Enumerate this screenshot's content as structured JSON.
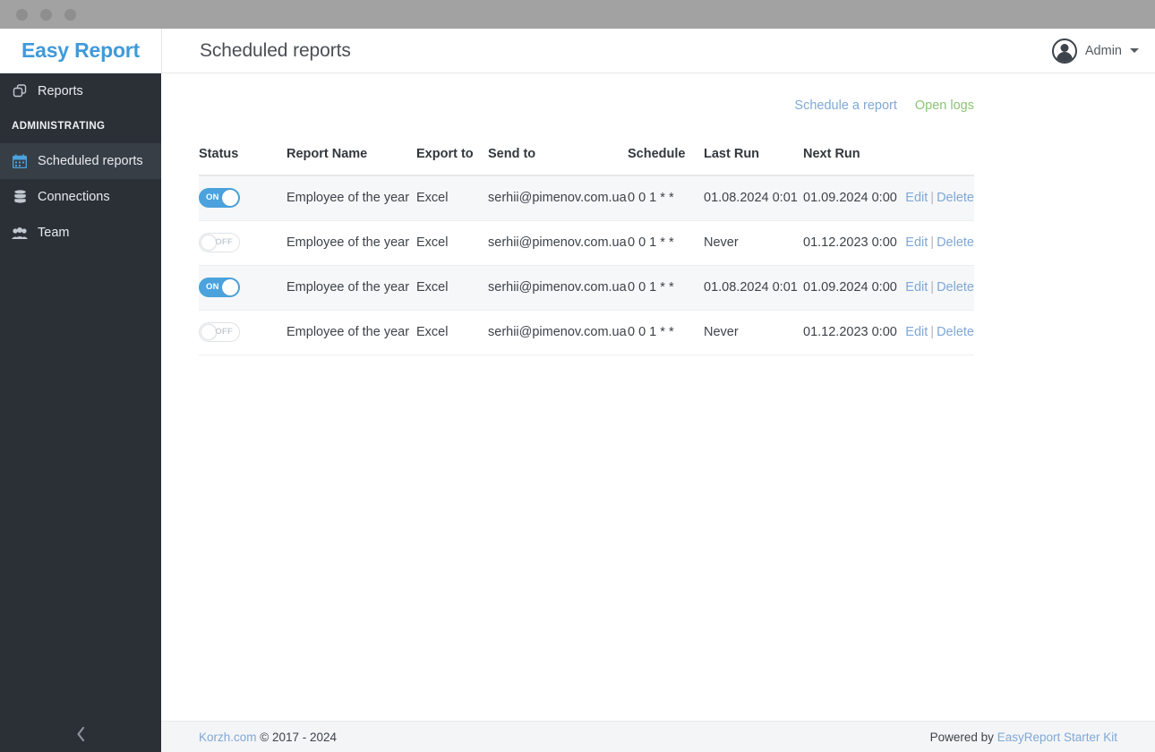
{
  "window": {
    "dots": [
      "close-dot",
      "minimize-dot",
      "maximize-dot"
    ]
  },
  "header": {
    "brand": "Easy Report",
    "page_title": "Scheduled reports",
    "user_name": "Admin"
  },
  "sidebar": {
    "items": [
      {
        "label": "Reports",
        "icon": "copy-icon",
        "active": false
      },
      {
        "label": "Scheduled reports",
        "icon": "calendar-icon",
        "active": true
      },
      {
        "label": "Connections",
        "icon": "database-icon",
        "active": false
      },
      {
        "label": "Team",
        "icon": "users-icon",
        "active": false
      }
    ],
    "section_label": "ADMINISTRATING",
    "collapse_icon": "chevron-left-icon"
  },
  "toolbar": {
    "schedule_report": "Schedule a report",
    "open_logs": "Open logs"
  },
  "table": {
    "columns": [
      "Status",
      "Report Name",
      "Export to",
      "Send to",
      "Schedule",
      "Last Run",
      "Next Run",
      ""
    ],
    "rows": [
      {
        "status": "ON",
        "enabled": true,
        "name": "Employee of the year",
        "export_to": "Excel",
        "send_to": "serhii@pimenov.com.ua",
        "schedule": "0 0 1 * *",
        "last_run": "01.08.2024 0:01",
        "next_run": "01.09.2024 0:00",
        "edit": "Edit",
        "separator": "|",
        "delete": "Delete"
      },
      {
        "status": "OFF",
        "enabled": false,
        "name": "Employee of the year",
        "export_to": "Excel",
        "send_to": "serhii@pimenov.com.ua",
        "schedule": "0 0 1 * *",
        "last_run": "Never",
        "next_run": "01.12.2023 0:00",
        "edit": "Edit",
        "separator": "|",
        "delete": "Delete"
      },
      {
        "status": "ON",
        "enabled": true,
        "name": "Employee of the year",
        "export_to": "Excel",
        "send_to": "serhii@pimenov.com.ua",
        "schedule": "0 0 1 * *",
        "last_run": "01.08.2024 0:01",
        "next_run": "01.09.2024 0:00",
        "edit": "Edit",
        "separator": "|",
        "delete": "Delete"
      },
      {
        "status": "OFF",
        "enabled": false,
        "name": "Employee of the year",
        "export_to": "Excel",
        "send_to": "serhii@pimenov.com.ua",
        "schedule": "0 0 1 * *",
        "last_run": "Never",
        "next_run": "01.12.2023 0:00",
        "edit": "Edit",
        "separator": "|",
        "delete": "Delete"
      }
    ]
  },
  "footer": {
    "copyright_link": "Korzh.com",
    "copyright_text": " © 2017 - 2024",
    "powered_by": "Powered by ",
    "powered_link": "EasyReport Starter Kit"
  },
  "colors": {
    "brand_blue": "#3f9ada",
    "toggle_on": "#4ba2dd",
    "link_blue": "#7fa8d6",
    "link_green": "#8cc474",
    "sidebar_bg": "#2b3036",
    "sidebar_active": "#383e45",
    "titlebar": "#a2a2a2",
    "row_alt": "#f6f7f8",
    "footer_bg": "#f4f5f7"
  }
}
